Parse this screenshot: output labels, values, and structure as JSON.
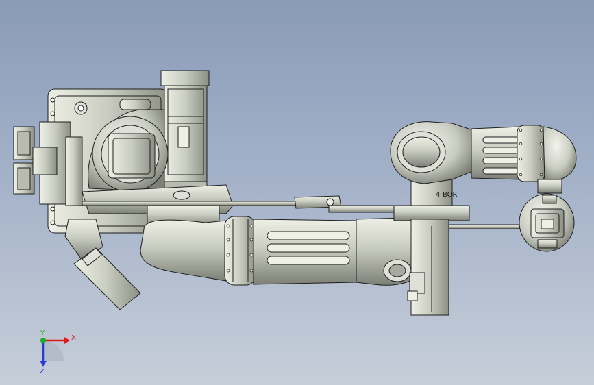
{
  "viewport": {
    "background_top": "#8a9bb8",
    "background_bottom": "#c6ced9"
  },
  "model": {
    "metal_fill": "#c9ccc1",
    "metal_shade": "#8c8f84",
    "edge_color": "#1e1e1e",
    "small_label_left": "4",
    "small_label_right": "BOR"
  },
  "triad": {
    "x_label": "X",
    "y_label": "Y",
    "z_label": "Z",
    "x_color": "#e01a1a",
    "y_color": "#1fae2a",
    "z_color": "#2a3ad6"
  }
}
